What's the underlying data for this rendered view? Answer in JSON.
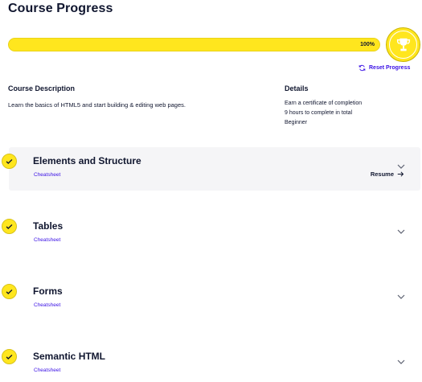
{
  "page": {
    "title": "Course Progress"
  },
  "progress": {
    "percent_label": "100%",
    "fraction": 1.0,
    "reset_label": "Reset Progress"
  },
  "colors": {
    "accent_yellow": "#ffe61e",
    "link_purple": "#3a10e5",
    "text_navy": "#10162f",
    "active_row_bg": "#f5f5f7"
  },
  "description": {
    "heading": "Course Description",
    "text": "Learn the basics of HTML5 and start building & editing web pages."
  },
  "details": {
    "heading": "Details",
    "lines": [
      "Earn a certificate of completion",
      "9 hours to complete in total",
      "Beginner"
    ]
  },
  "modules": [
    {
      "title": "Elements and Structure",
      "cheatsheet": "Cheatsheet",
      "resume": "Resume",
      "completed": true,
      "active": true
    },
    {
      "title": "Tables",
      "cheatsheet": "Cheatsheet",
      "completed": true
    },
    {
      "title": "Forms",
      "cheatsheet": "Cheatsheet",
      "completed": true
    },
    {
      "title": "Semantic HTML",
      "cheatsheet": "Cheatsheet",
      "completed": true
    }
  ],
  "icons": {
    "trophy": "trophy-icon",
    "reset": "refresh-icon",
    "check": "check-icon",
    "chevron": "chevron-down-icon",
    "arrow": "arrow-right-icon"
  }
}
